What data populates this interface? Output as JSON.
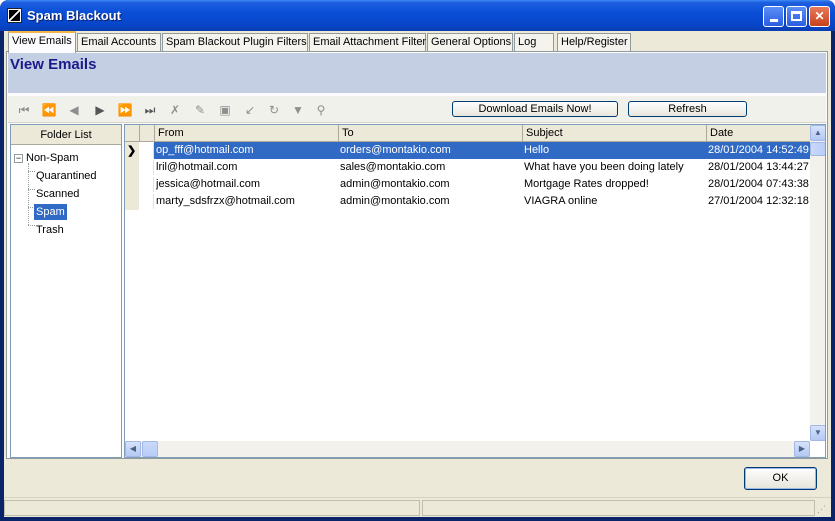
{
  "window": {
    "title": "Spam Blackout"
  },
  "tabs": [
    {
      "label": "View Emails"
    },
    {
      "label": "Email Accounts"
    },
    {
      "label": "Spam Blackout Plugin Filters"
    },
    {
      "label": "Email Attachment Filter"
    },
    {
      "label": "General Options"
    },
    {
      "label": "Log"
    },
    {
      "label": "Help/Register"
    }
  ],
  "page": {
    "title": "View Emails"
  },
  "toolbar": {
    "download_label": "Download Emails Now!",
    "refresh_label": "Refresh"
  },
  "folders": {
    "header": "Folder List",
    "root": "Non-Spam",
    "items": [
      {
        "label": "Quarantined"
      },
      {
        "label": "Scanned"
      },
      {
        "label": "Spam"
      },
      {
        "label": "Trash"
      }
    ],
    "selected": "Spam"
  },
  "grid": {
    "columns": {
      "from": "From",
      "to": "To",
      "subject": "Subject",
      "date": "Date"
    },
    "rows": [
      {
        "from": "op_fff@hotmail.com",
        "to": "orders@montakio.com",
        "subject": "Hello",
        "date": "28/01/2004 14:52:49"
      },
      {
        "from": "lril@hotmail.com",
        "to": "sales@montakio.com",
        "subject": "What have you been doing lately",
        "date": "28/01/2004 13:44:27"
      },
      {
        "from": "jessica@hotmail.com",
        "to": "admin@montakio.com",
        "subject": "Mortgage Rates dropped!",
        "date": "28/01/2004 07:43:38"
      },
      {
        "from": "marty_sdsfrzx@hotmail.com",
        "to": "admin@montakio.com",
        "subject": "VIAGRA online",
        "date": "27/01/2004 12:32:18"
      }
    ]
  },
  "footer": {
    "ok_label": "OK"
  }
}
